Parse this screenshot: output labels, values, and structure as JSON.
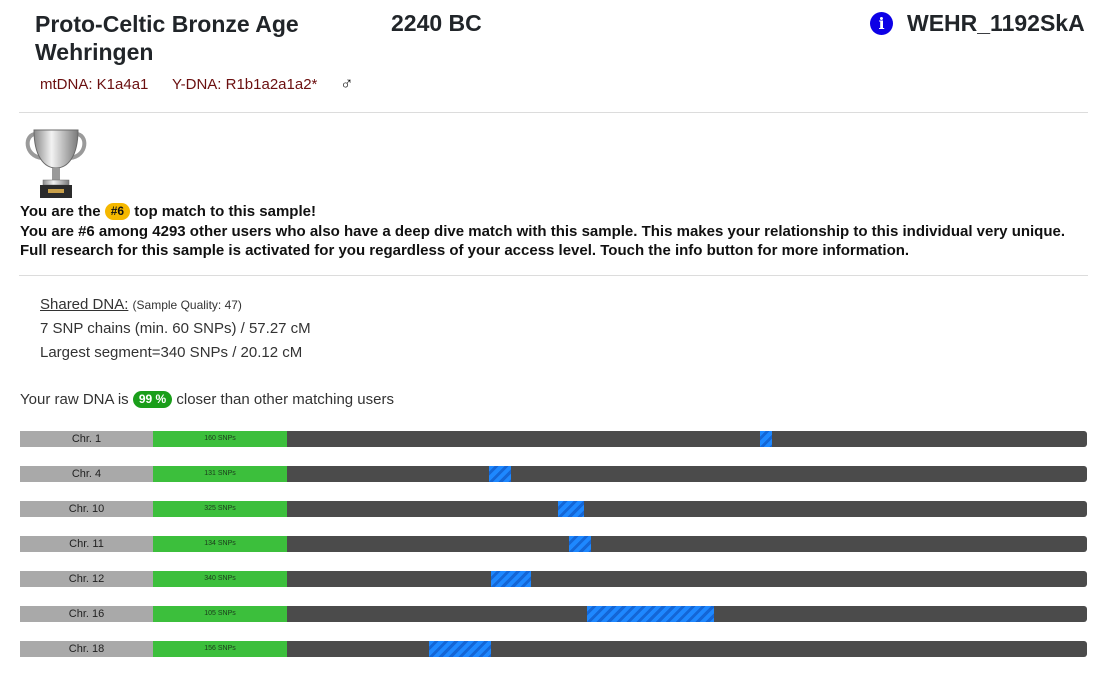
{
  "header": {
    "title_line1": "Proto-Celtic Bronze Age",
    "title_line2": "Wehringen",
    "era": "2240 BC",
    "sample_id": "WEHR_1192SkA",
    "info_icon": "info-icon",
    "mtdna": "mtDNA: K1a4a1",
    "ydna": "Y-DNA: R1b1a2a1a2*",
    "sex_symbol": "♂"
  },
  "top_match": {
    "trophy_icon": "silver-trophy-icon",
    "line1_prefix": "You are the",
    "rank": "#6",
    "line1_suffix": "top match to this sample!",
    "line2": "You are #6 among 4293 other users who also have a deep dive match with this sample. This makes your relationship to this individual very unique.",
    "line3": "Full research for this sample is activated for you regardless of your access level. Touch the info button for more information."
  },
  "shared_dna": {
    "label": "Shared DNA:",
    "quality": "(Sample Quality: 47)",
    "chains": "7 SNP chains (min. 60 SNPs) / 57.27 cM",
    "largest": "Largest segment=340 SNPs / 20.12 cM"
  },
  "raw_dna": {
    "prefix": "Your raw DNA is",
    "percent": "99 %",
    "suffix": "closer than other matching users"
  },
  "colors": {
    "label_bg": "#a9a9a9",
    "snp_bg": "#3cbf3c",
    "track_bg": "#4b4b4b",
    "segment": "#1e88ff",
    "rank_badge": "#f5b800",
    "percent_badge": "#1a9e1a"
  },
  "chromosomes": [
    {
      "label": "Chr. 1",
      "snps": "160 SNPs",
      "seg_start": 0.591,
      "seg_end": 0.606
    },
    {
      "label": "Chr. 4",
      "snps": "131 SNPs",
      "seg_start": 0.253,
      "seg_end": 0.281
    },
    {
      "label": "Chr. 10",
      "snps": "325 SNPs",
      "seg_start": 0.339,
      "seg_end": 0.371
    },
    {
      "label": "Chr. 11",
      "snps": "134 SNPs",
      "seg_start": 0.353,
      "seg_end": 0.381
    },
    {
      "label": "Chr. 12",
      "snps": "340 SNPs",
      "seg_start": 0.255,
      "seg_end": 0.305
    },
    {
      "label": "Chr. 16",
      "snps": "105 SNPs",
      "seg_start": 0.375,
      "seg_end": 0.534
    },
    {
      "label": "Chr. 18",
      "snps": "156 SNPs",
      "seg_start": 0.178,
      "seg_end": 0.256
    }
  ]
}
